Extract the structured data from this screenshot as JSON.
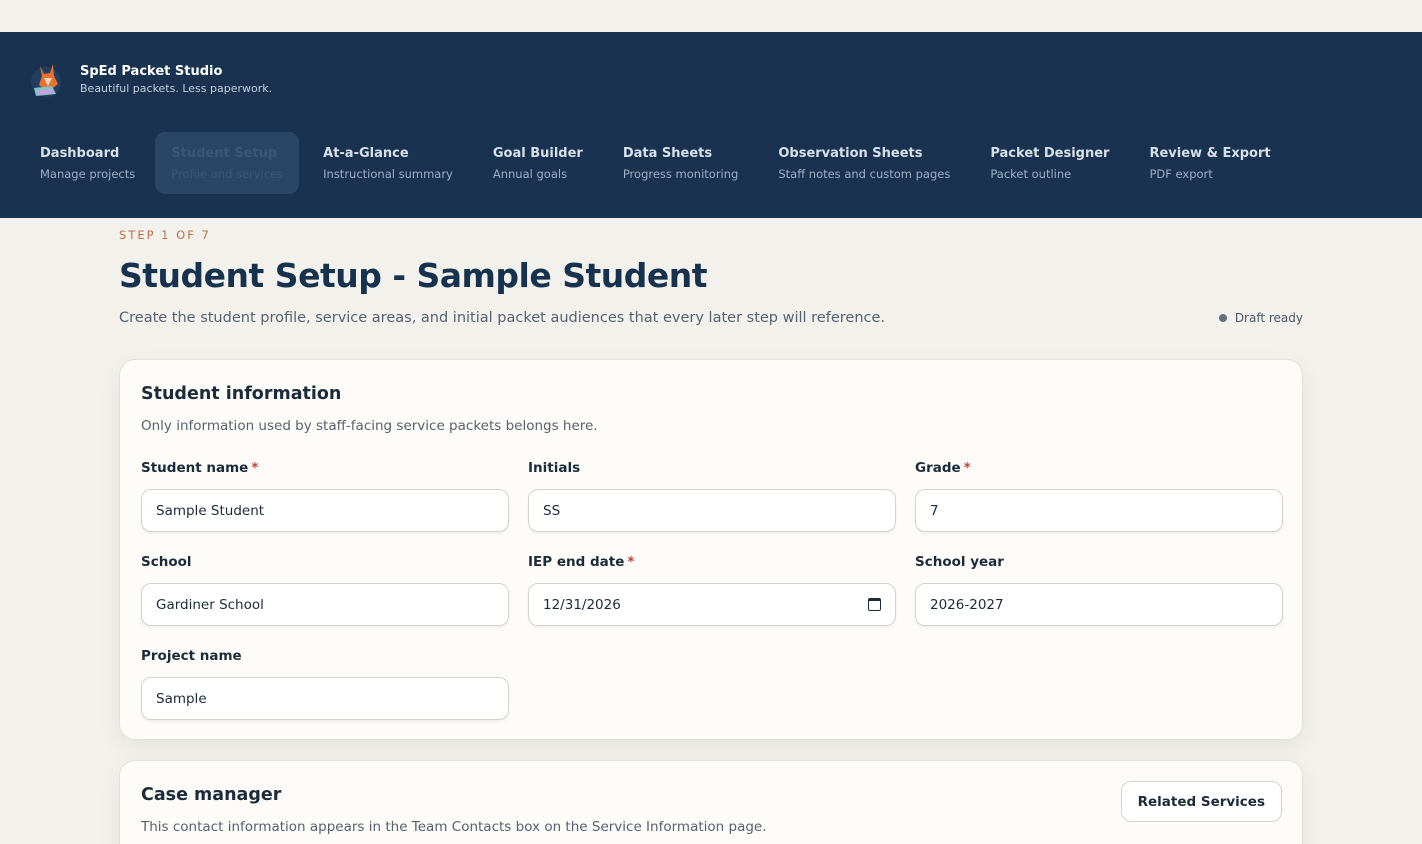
{
  "app": {
    "title": "SpEd Packet Studio",
    "tagline": "Beautiful packets. Less paperwork."
  },
  "nav": [
    {
      "label": "Dashboard",
      "sub": "Manage projects"
    },
    {
      "label": "Student Setup",
      "sub": "Profile and services",
      "active": true
    },
    {
      "label": "At-a-Glance",
      "sub": "Instructional summary"
    },
    {
      "label": "Goal Builder",
      "sub": "Annual goals"
    },
    {
      "label": "Data Sheets",
      "sub": "Progress monitoring"
    },
    {
      "label": "Observation Sheets",
      "sub": "Staff notes and custom pages"
    },
    {
      "label": "Packet Designer",
      "sub": "Packet outline"
    },
    {
      "label": "Review & Export",
      "sub": "PDF export"
    }
  ],
  "page": {
    "step": "STEP 1 OF 7",
    "title": "Student Setup - Sample Student",
    "description": "Create the student profile, service areas, and initial packet audiences that every later step will reference.",
    "status": "Draft ready"
  },
  "student_info": {
    "title": "Student information",
    "description": "Only information used by staff-facing service packets belongs here.",
    "fields": {
      "student_name": {
        "label": "Student name",
        "value": "Sample Student",
        "required": "*"
      },
      "initials": {
        "label": "Initials",
        "value": "SS"
      },
      "grade": {
        "label": "Grade",
        "value": "7",
        "required": "*"
      },
      "school": {
        "label": "School",
        "value": "Gardiner School"
      },
      "iep_end_date": {
        "label": "IEP end date",
        "value": "12/31/2026",
        "required": "*"
      },
      "school_year": {
        "label": "School year",
        "value": "2026-2027"
      },
      "project_name": {
        "label": "Project name",
        "value": "Sample"
      }
    }
  },
  "case_manager": {
    "title": "Case manager",
    "description": "This contact information appears in the Team Contacts box on the Service Information page.",
    "button": "Related Services"
  },
  "colors": {
    "header_bg": "#18324f",
    "accent": "#c0704a",
    "required": "#c0433d",
    "page_bg": "#f3f1ec"
  }
}
